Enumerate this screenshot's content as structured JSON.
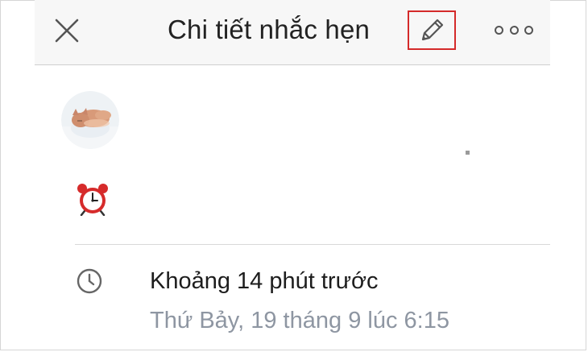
{
  "header": {
    "title": "Chi tiết nhắc hẹn",
    "close_icon": "close-icon",
    "edit_icon": "pencil-icon",
    "more_icon": "more-dots-icon"
  },
  "reminder": {
    "avatar_icon": "cat-avatar",
    "alarm_icon": "alarm-clock-icon",
    "time_icon": "clock-icon",
    "time_ago": "Khoảng 14 phút trước",
    "date": "Thứ Bảy, 19 tháng 9 lúc 6:15"
  },
  "colors": {
    "highlight_border": "#d42a2a",
    "header_bg": "#f7f7f7",
    "secondary_text": "#8e96a2"
  }
}
